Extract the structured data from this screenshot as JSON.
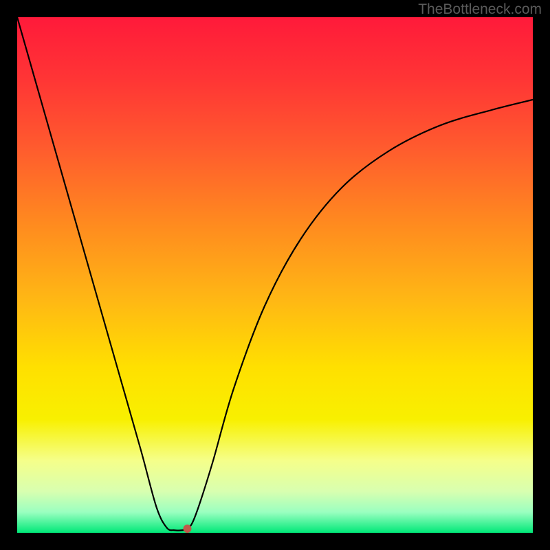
{
  "watermark": "TheBottleneck.com",
  "chart_data": {
    "type": "line",
    "title": "",
    "xlabel": "",
    "ylabel": "",
    "xlim": [
      0,
      100
    ],
    "ylim": [
      0,
      100
    ],
    "background": {
      "type": "vertical-gradient",
      "stops": [
        {
          "pos": 0.0,
          "color": "#ff1a3a"
        },
        {
          "pos": 0.12,
          "color": "#ff3535"
        },
        {
          "pos": 0.25,
          "color": "#ff5a2e"
        },
        {
          "pos": 0.4,
          "color": "#ff8a1f"
        },
        {
          "pos": 0.55,
          "color": "#ffb814"
        },
        {
          "pos": 0.68,
          "color": "#ffe000"
        },
        {
          "pos": 0.78,
          "color": "#f8f000"
        },
        {
          "pos": 0.86,
          "color": "#f5ff8a"
        },
        {
          "pos": 0.92,
          "color": "#d8ffb0"
        },
        {
          "pos": 0.96,
          "color": "#9affc0"
        },
        {
          "pos": 1.0,
          "color": "#00e878"
        }
      ]
    },
    "series": [
      {
        "name": "bottleneck-curve",
        "color": "#000000",
        "x": [
          0,
          4,
          8,
          12,
          16,
          20,
          24,
          27,
          29,
          30.5,
          32,
          33,
          34,
          35.5,
          38,
          42,
          48,
          55,
          63,
          72,
          82,
          92,
          100
        ],
        "y": [
          100,
          86,
          72,
          58,
          44,
          30,
          16,
          5,
          1,
          0.5,
          0.5,
          0.8,
          2,
          6,
          14,
          28,
          44,
          57,
          67,
          74,
          79,
          82,
          84
        ]
      }
    ],
    "marker": {
      "name": "optimum-point",
      "x": 33,
      "y": 0.8,
      "color": "#c05a4a",
      "radius": 6
    }
  }
}
